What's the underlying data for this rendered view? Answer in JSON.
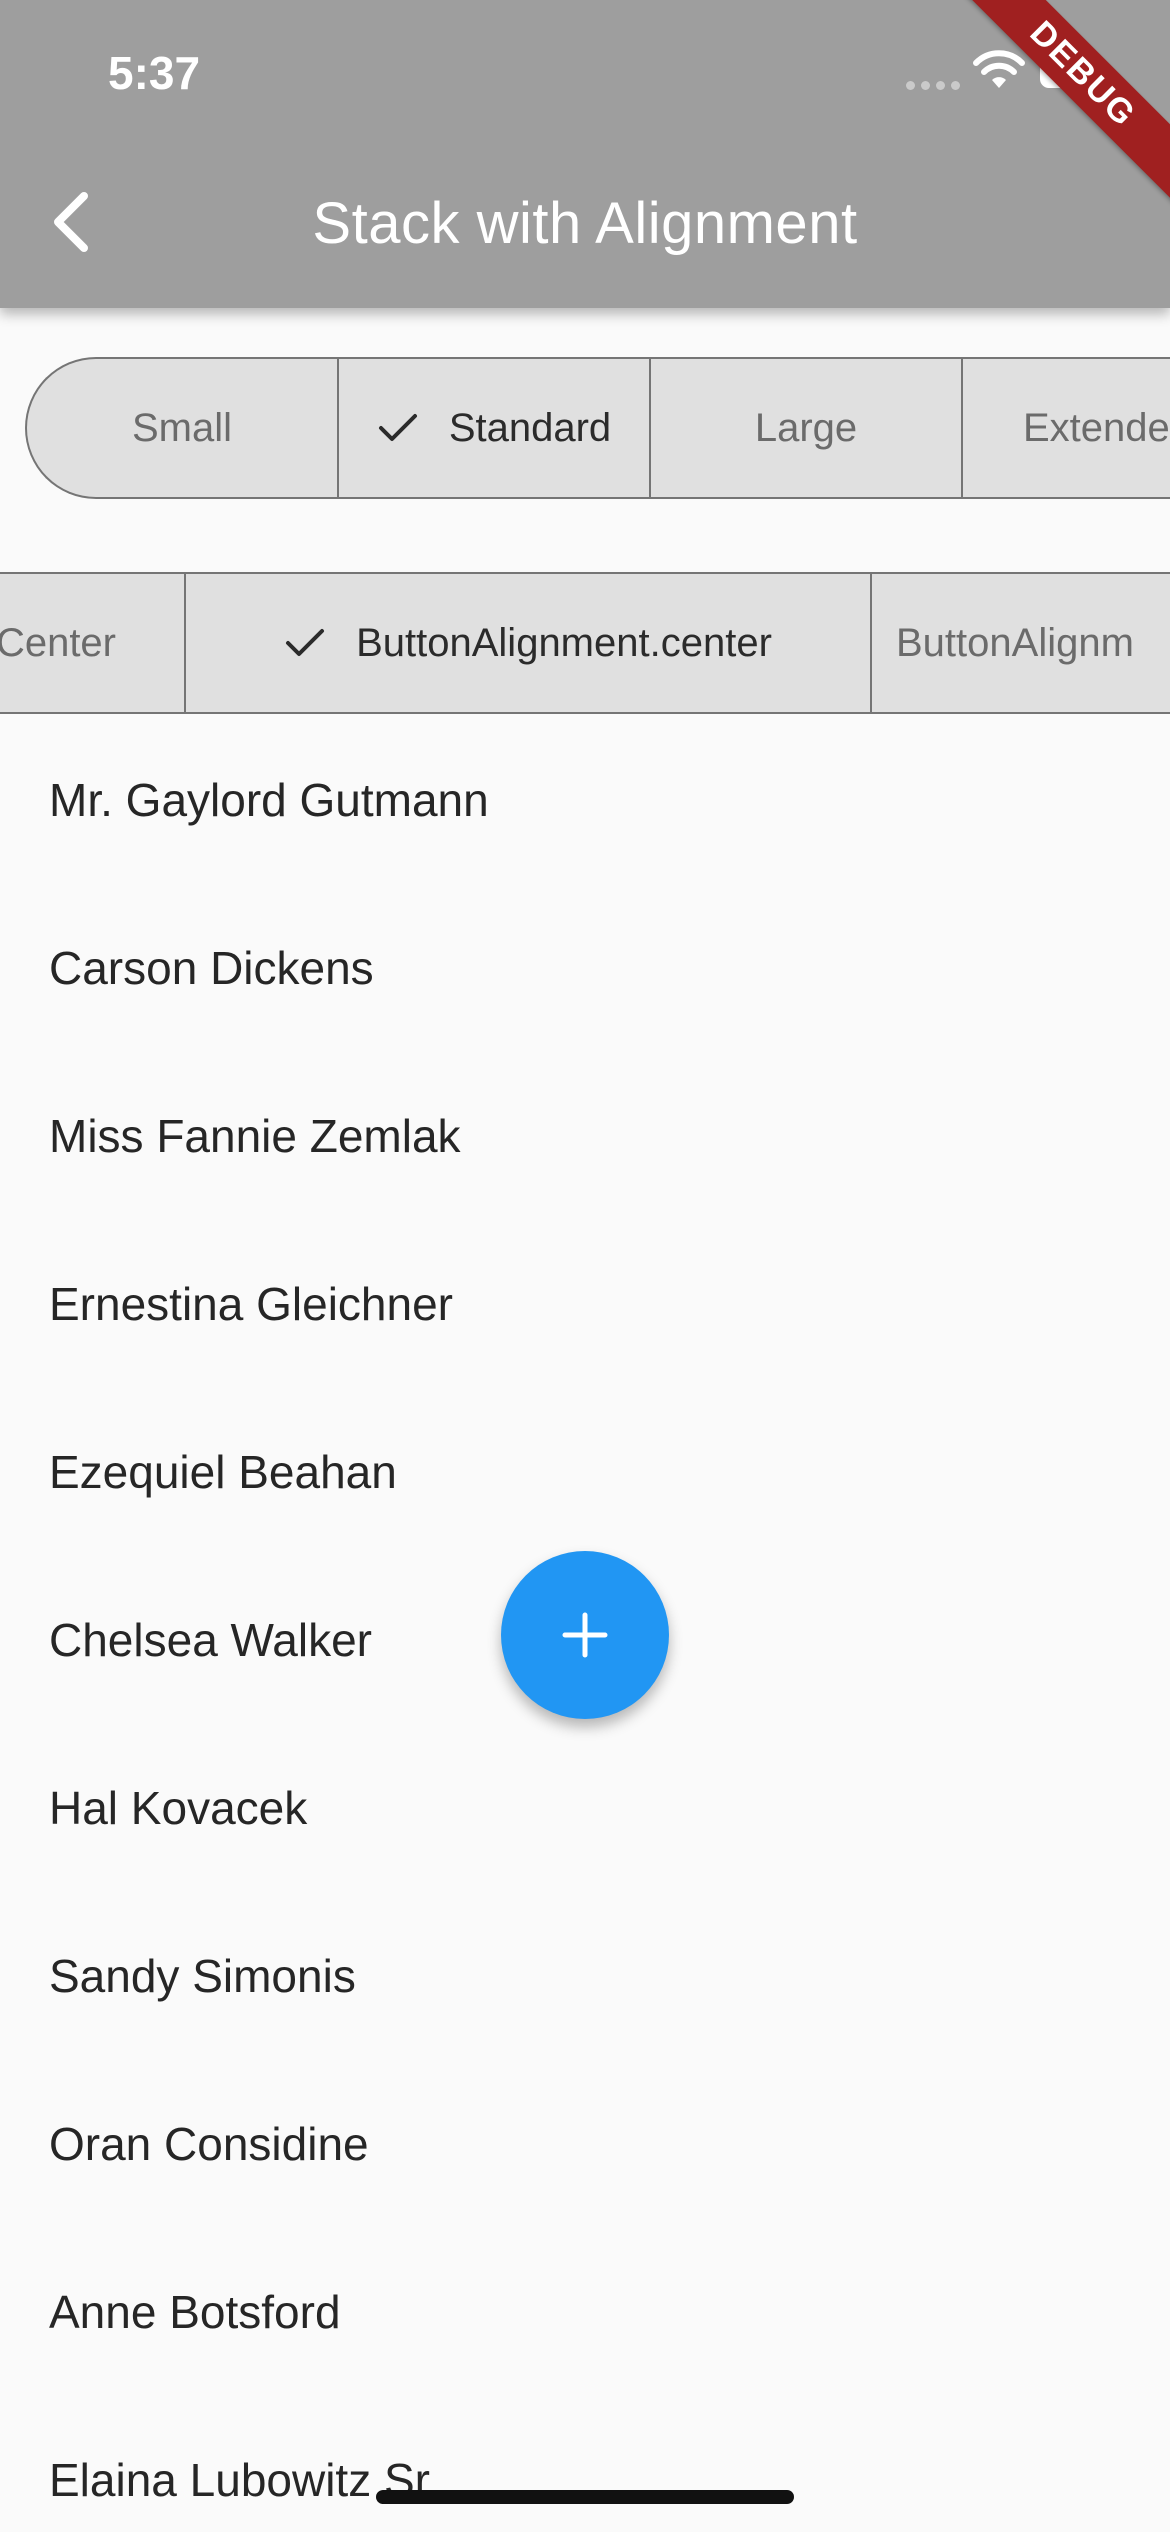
{
  "status_bar": {
    "time": "5:37"
  },
  "app_bar": {
    "title": "Stack with Alignment",
    "debug_banner": "DEBUG"
  },
  "size_options": [
    {
      "label": "Small",
      "selected": false
    },
    {
      "label": "Standard",
      "selected": true
    },
    {
      "label": "Large",
      "selected": false
    },
    {
      "label": "Extende",
      "selected": false
    }
  ],
  "alignment_options": [
    {
      "label": "Center",
      "selected": false
    },
    {
      "label": "ButtonAlignment.center",
      "selected": true
    },
    {
      "label": "ButtonAlignm",
      "selected": false
    }
  ],
  "list_items": [
    "Mr. Gaylord Gutmann",
    "Carson Dickens",
    "Miss Fannie Zemlak",
    "Ernestina Gleichner",
    "Ezequiel Beahan",
    "Chelsea Walker",
    "Hal Kovacek",
    "Sandy Simonis",
    "Oran Considine",
    "Anne Botsford",
    "Elaina Lubowitz Sr."
  ],
  "fab": {
    "icon": "plus-icon",
    "color": "#2196f3"
  },
  "colors": {
    "app_bar": "#9e9e9e",
    "debug_banner": "#a02020"
  }
}
